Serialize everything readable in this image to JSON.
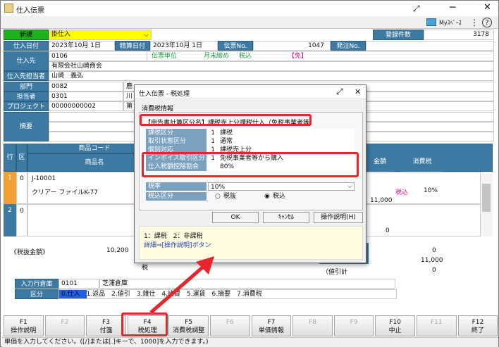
{
  "window": {
    "title": "仕入伝票",
    "myspace": "Myｽﾍﾟｰｽ"
  },
  "header": {
    "mode": "新規",
    "type": "掛仕入",
    "record_label": "登録件数",
    "record_count": "3178",
    "date_label": "仕入日付",
    "date": "2023年10月 1日",
    "settle_label": "精算日付",
    "settle_date": "2023年10月 1日",
    "slip_label": "伝票No.",
    "slip_no": "1047",
    "order_label": "発注No.",
    "supplier_label": "仕入先",
    "supplier_code": "0106",
    "supplier_name": "有限会社山崎商会",
    "tax_unit": "伝票単位",
    "cutoff": "月末締め",
    "taxin": "税込",
    "mark": "【免】",
    "person_label": "仕入先担当者",
    "person": "山崎　義弘",
    "dept_label": "部門",
    "dept_code": "0082",
    "dept_partial": "鹿",
    "staff_label": "担当者",
    "staff_code": "0301",
    "staff_partial": "川",
    "project_label": "プロジェクト",
    "project_code": "00000000002",
    "project_partial": "第",
    "memo_label": "摘要"
  },
  "grid": {
    "col_row": "行",
    "col_div": "区",
    "col_code": "商品コード",
    "col_name": "商品名",
    "col_amount": "金額",
    "col_tax": "消費税",
    "r1_no": "1",
    "r1_div": "0",
    "r1_code": "J-10001",
    "r1_name": "クリアー ファイルK-77",
    "r1_amount": "11,000",
    "r1_taxin": "税込",
    "r1_rate": "10%",
    "r2_no": "2",
    "r2_div": "0",
    "r2_amount": "0"
  },
  "totals": {
    "pretax_label": "《税抜金額》",
    "pretax": "10,200",
    "v1": "0",
    "v2": "11,000",
    "balance_label": "（値引計",
    "v3": "0",
    "partial": "税"
  },
  "footer": {
    "warehouse_label": "入力行倉庫",
    "warehouse_code": "0101",
    "warehouse_name": "芝浦倉庫",
    "kubun_label": "区分",
    "kubun_items": "0.仕入　1.返品　2.値引　3.雑仕　4.諸費　5.運賃　6.摘要　7.消費税"
  },
  "dialog": {
    "title": "仕入伝票 - 税処理",
    "section": "消費税情報",
    "summary": "【申告書計算区分名】課税売上分課税仕入（免税事業者等）",
    "rows": [
      {
        "k": "課税区分",
        "n": "1",
        "v": "課税"
      },
      {
        "k": "取引状態区分",
        "n": "1",
        "v": "通常"
      },
      {
        "k": "個別対応",
        "n": "1",
        "v": "課税売上分"
      },
      {
        "k": "インボイス取引区分",
        "n": "1",
        "v": "免税事業者等から購入"
      },
      {
        "k": "仕入税額控除割合",
        "n": "",
        "v": "80%"
      }
    ],
    "rate_label": "税率",
    "rate": "10%",
    "tax_kubun_label": "税込区分",
    "opt_nuki": "税抜",
    "opt_komi": "税込",
    "ok": "OK",
    "cancel": "ｷｬﾝｾﾙ",
    "help": "操作説明(H)",
    "hint1": "1：課税　2：非課税",
    "hint2": "詳細⇒[操作説明]ボタン"
  },
  "fkeys": [
    {
      "k": "F1",
      "l": "操作説明"
    },
    {
      "k": "F2",
      "l": ""
    },
    {
      "k": "F3",
      "l": "付箋"
    },
    {
      "k": "F4",
      "l": "税処理"
    },
    {
      "k": "F5",
      "l": "消費税調整"
    },
    {
      "k": "F6",
      "l": ""
    },
    {
      "k": "F7",
      "l": "単価情報"
    },
    {
      "k": "F8",
      "l": ""
    },
    {
      "k": "F9",
      "l": ""
    },
    {
      "k": "F10",
      "l": "中止"
    },
    {
      "k": "F11",
      "l": ""
    },
    {
      "k": "F12",
      "l": "終了"
    }
  ],
  "status": "単価を入力してください。([/]または[.]キーで、1000]を入力できます。)",
  "colors": {
    "label_blue": "#3d7aa3",
    "highlight_red": "#e6262c",
    "green": "#1eb11e",
    "yellow": "#ffff00"
  }
}
